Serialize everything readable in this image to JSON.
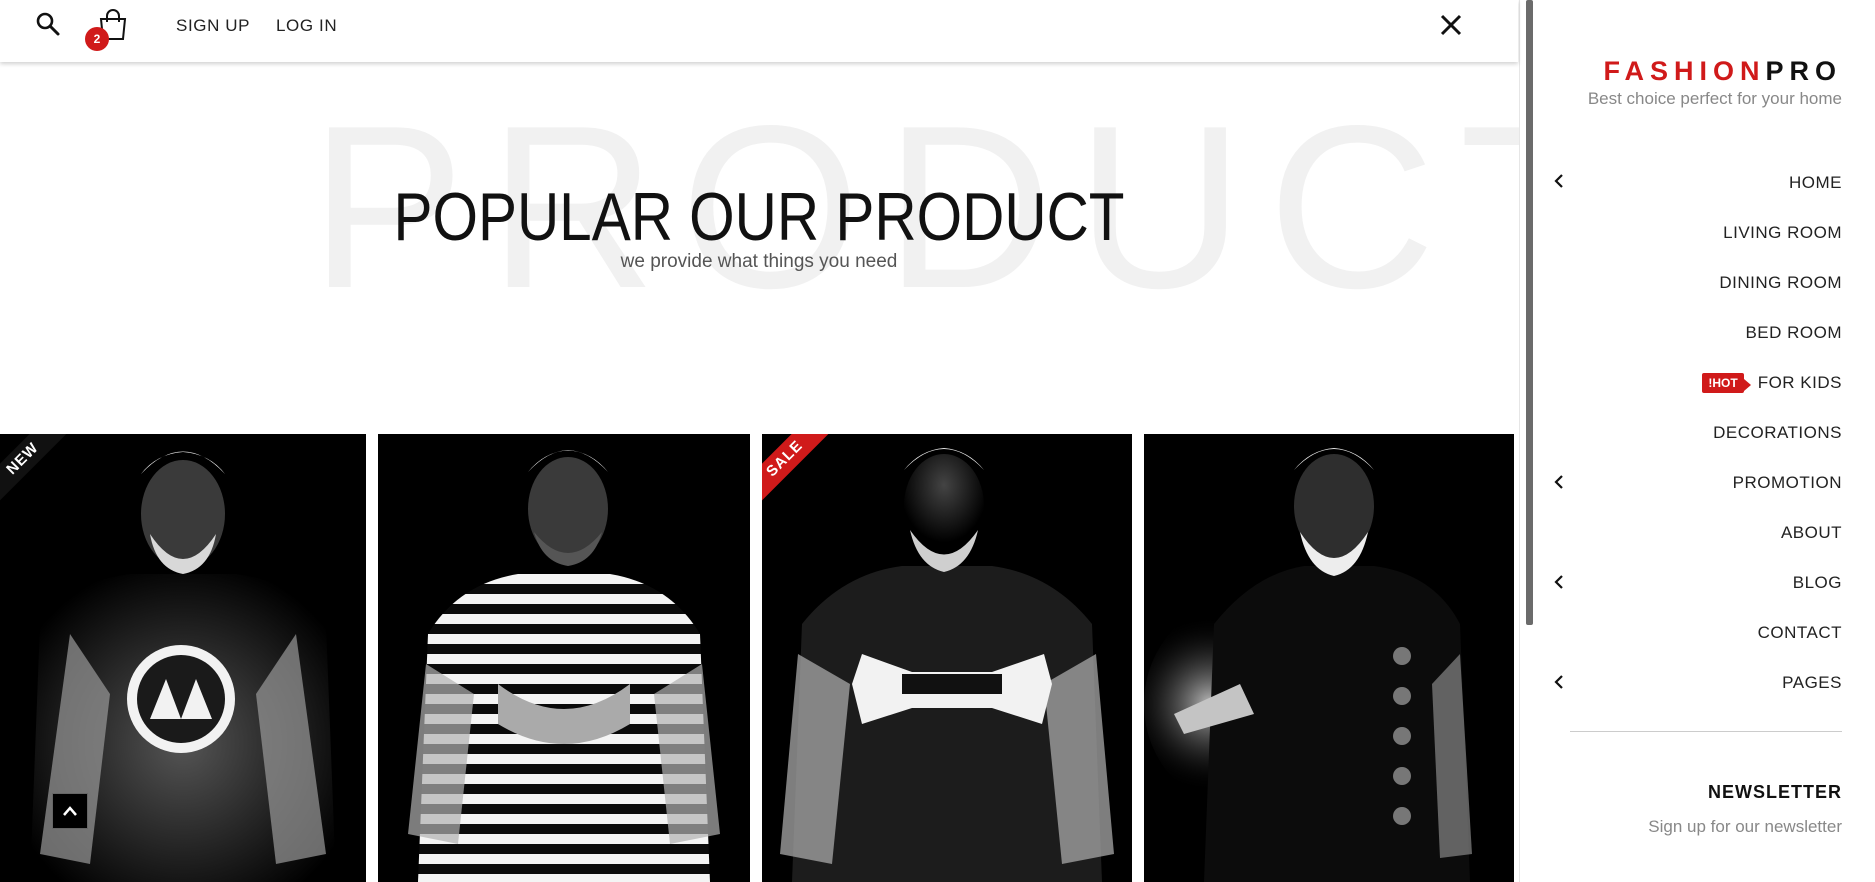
{
  "topbar": {
    "search_icon": "search-icon",
    "cart_icon": "shopping-bag-icon",
    "cart_count": "2",
    "signup_label": "SIGN UP",
    "login_label": "LOG IN",
    "close_icon": "close-icon"
  },
  "hero": {
    "background_word": "PRODUCT",
    "title": "POPULAR OUR PRODUCT",
    "subtitle": "we provide what things you need"
  },
  "products": [
    {
      "badge": "NEW",
      "shirt": "graphic-tee"
    },
    {
      "badge": "",
      "shirt": "striped-tee"
    },
    {
      "badge": "SALE",
      "shirt": "logo-tee"
    },
    {
      "badge": "",
      "shirt": "dark-tee"
    }
  ],
  "scroll_top_icon": "chevron-up-icon",
  "sidemenu": {
    "logo_part1": "FASHION",
    "logo_part2": "PRO",
    "tagline": "Best choice perfect for your home",
    "items": [
      {
        "label": "HOME",
        "has_submenu": true
      },
      {
        "label": "LIVING ROOM",
        "has_submenu": false
      },
      {
        "label": "DINING ROOM",
        "has_submenu": false
      },
      {
        "label": "BED ROOM",
        "has_submenu": false
      },
      {
        "label": "FOR KIDS",
        "has_submenu": false,
        "badge": "!HOT"
      },
      {
        "label": "DECORATIONS",
        "has_submenu": false
      },
      {
        "label": "PROMOTION",
        "has_submenu": true
      },
      {
        "label": "ABOUT",
        "has_submenu": false
      },
      {
        "label": "BLOG",
        "has_submenu": true
      },
      {
        "label": "CONTACT",
        "has_submenu": false
      },
      {
        "label": "PAGES",
        "has_submenu": true
      }
    ],
    "newsletter_title": "NEWSLETTER",
    "newsletter_sub": "Sign up for our newsletter"
  },
  "colors": {
    "accent": "#d01a1a",
    "text": "#111111",
    "muted": "#888888"
  }
}
